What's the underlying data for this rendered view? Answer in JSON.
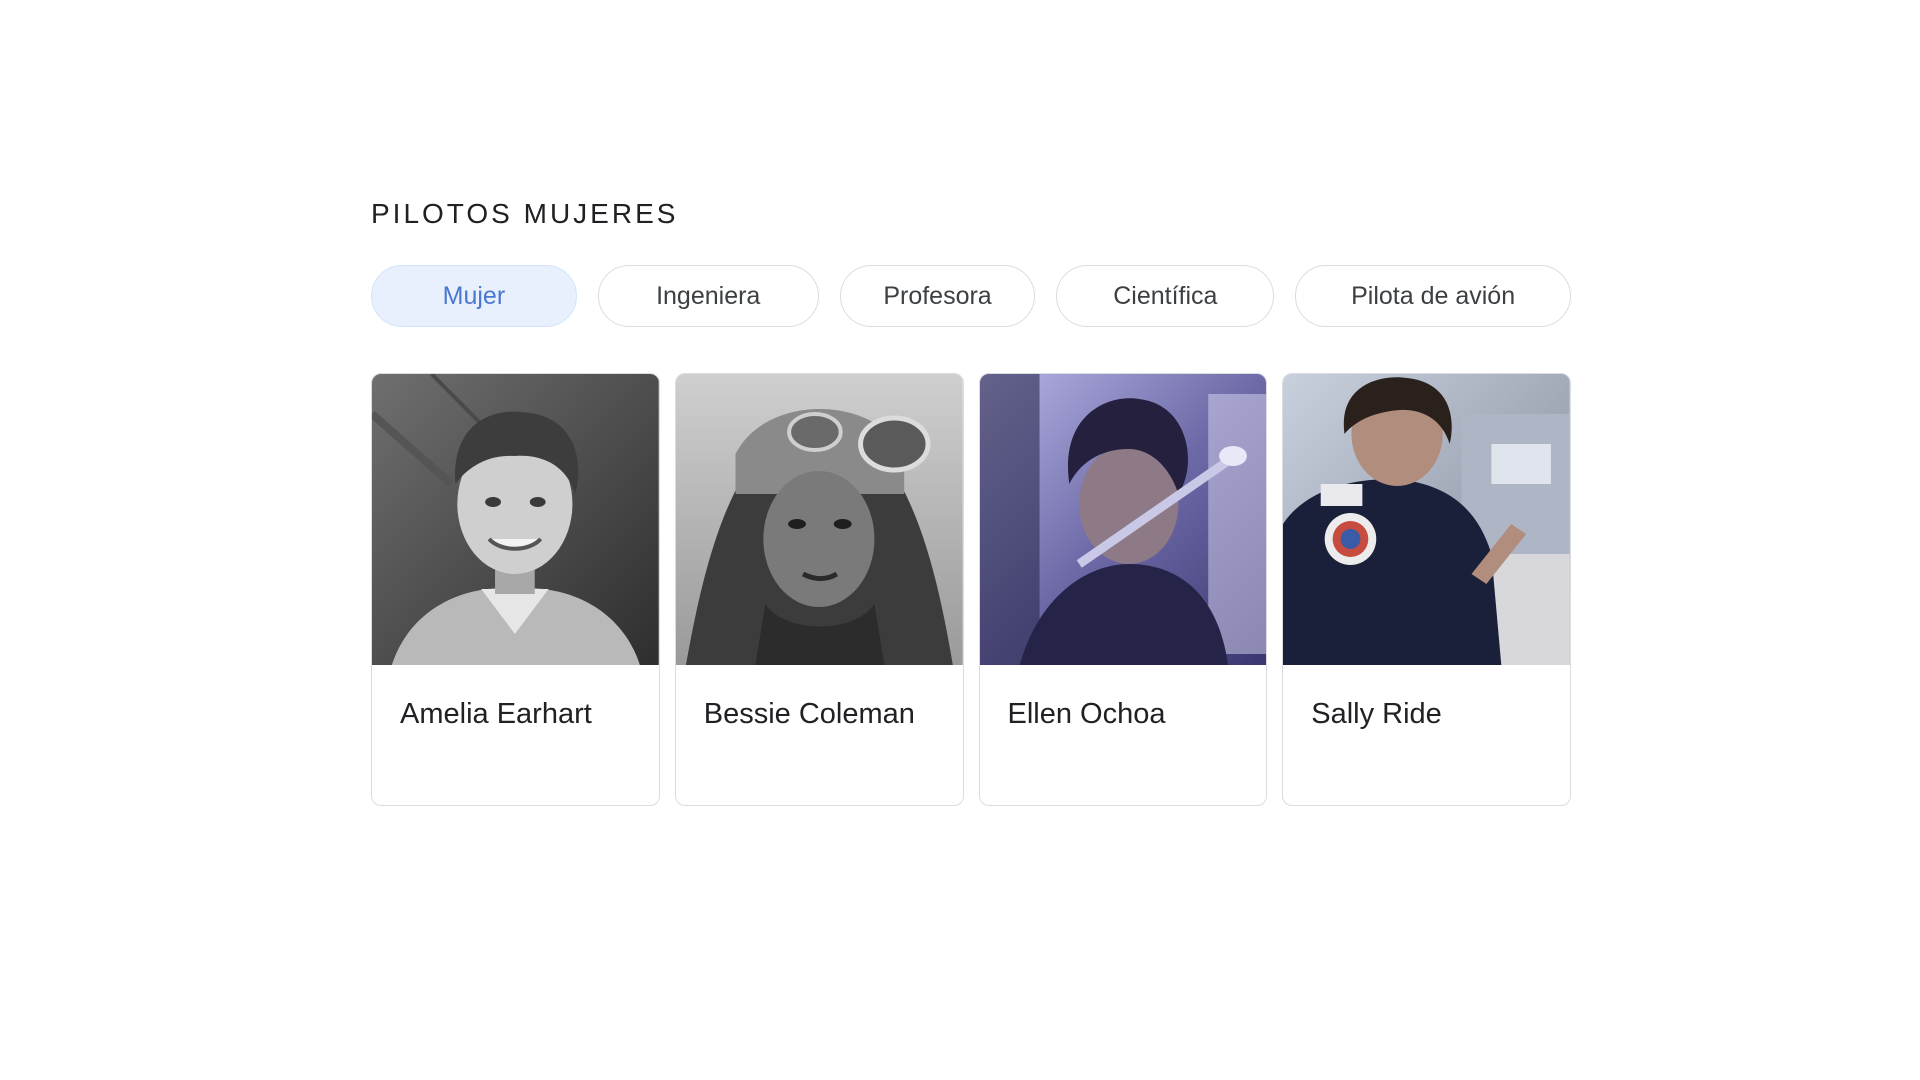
{
  "section": {
    "title": "PILOTOS MUJERES"
  },
  "chips": [
    {
      "label": "Mujer",
      "selected": true
    },
    {
      "label": "Ingeniera",
      "selected": false
    },
    {
      "label": "Profesora",
      "selected": false
    },
    {
      "label": "Científica",
      "selected": false
    },
    {
      "label": "Pilota de avión",
      "selected": false
    }
  ],
  "cards": [
    {
      "name": "Amelia Earhart",
      "photo": "black-and-white portrait"
    },
    {
      "name": "Bessie Coleman",
      "photo": "black-and-white portrait with aviator helmet"
    },
    {
      "name": "Ellen Ochoa",
      "photo": "color photo in spacecraft, blue tint"
    },
    {
      "name": "Sally Ride",
      "photo": "color photo in dark polo shirt with mission patch"
    }
  ],
  "colors": {
    "chip_selected_bg": "#e8f0fe",
    "chip_selected_text": "#4a78d0",
    "border": "#dadce0",
    "text": "#202124"
  }
}
